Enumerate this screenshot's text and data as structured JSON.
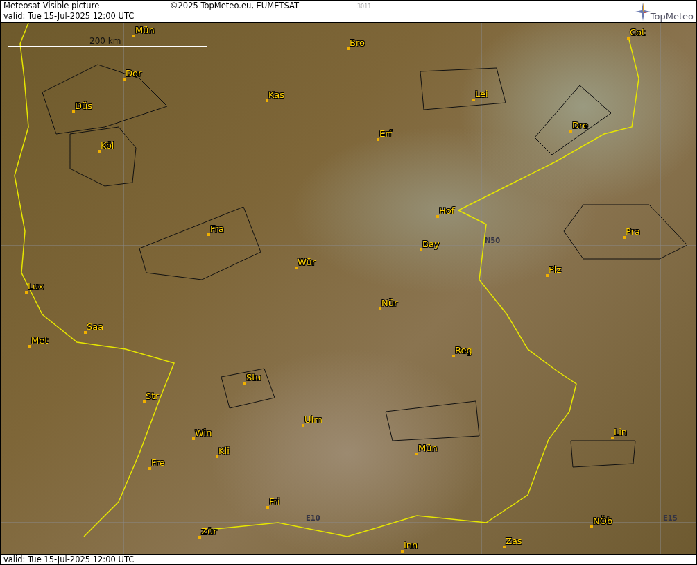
{
  "header": {
    "title": "Meteosat Visible picture",
    "copyright": "©2025 TopMeteo.eu, EUMETSAT",
    "code": "3011",
    "valid": "valid:  Tue  15-Jul-2025  12:00 UTC",
    "logo": "TopMeteo"
  },
  "map": {
    "scale_label": "200 km",
    "cities": [
      {
        "name": "Mün"
      },
      {
        "name": "Bro"
      },
      {
        "name": "Cot"
      },
      {
        "name": "Dor"
      },
      {
        "name": "Kas"
      },
      {
        "name": "Lei"
      },
      {
        "name": "Düs"
      },
      {
        "name": "Dre"
      },
      {
        "name": "Erf"
      },
      {
        "name": "Köl"
      },
      {
        "name": "Hof"
      },
      {
        "name": "Fra"
      },
      {
        "name": "Pra"
      },
      {
        "name": "Bay"
      },
      {
        "name": "Wür"
      },
      {
        "name": "Plz"
      },
      {
        "name": "Lux"
      },
      {
        "name": "Nür"
      },
      {
        "name": "Saa"
      },
      {
        "name": "Met"
      },
      {
        "name": "Reg"
      },
      {
        "name": "Stu"
      },
      {
        "name": "Str"
      },
      {
        "name": "Ulm"
      },
      {
        "name": "Win"
      },
      {
        "name": "Lin"
      },
      {
        "name": "Kli"
      },
      {
        "name": "Mün"
      },
      {
        "name": "Fre"
      },
      {
        "name": "Fri"
      },
      {
        "name": "NÖb"
      },
      {
        "name": "Zür"
      },
      {
        "name": "Zas"
      },
      {
        "name": "Inn"
      }
    ],
    "grid_labels": [
      "N50",
      "E10",
      "E15"
    ]
  },
  "footer": {
    "valid": "valid:  Tue  15-Jul-2025  12:00 UTC"
  }
}
